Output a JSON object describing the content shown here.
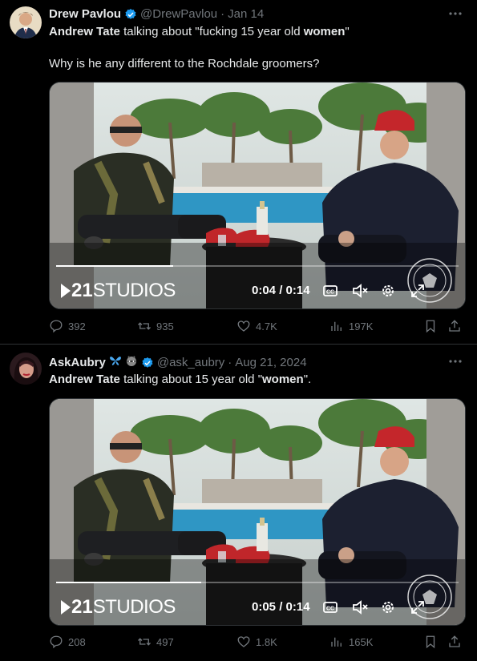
{
  "tweets": [
    {
      "author_name": "Drew Pavlou",
      "handle": "@DrewPavlou",
      "dot": "·",
      "date": "Jan 14",
      "line1_a": "Andrew Tate",
      "line1_b": " talking about \"fucking 15 year old ",
      "line1_c": "women",
      "line1_d": "\"",
      "line2": "Why is he any different to the Rochdale groomers?",
      "video": {
        "logo_num": "21",
        "logo_text": "STUDIOS",
        "time": "0:04 / 0:14",
        "progress": 0.29
      },
      "stats": {
        "replies": "392",
        "reposts": "935",
        "likes": "4.7K",
        "views": "197K"
      }
    },
    {
      "author_name": "AskAubry",
      "handle": "@ask_aubry",
      "dot": "·",
      "date": "Aug 21, 2024",
      "line1_a": "Andrew Tate",
      "line1_b": " talking about 15 year old \"",
      "line1_c": "women",
      "line1_d": "\".",
      "video": {
        "logo_num": "21",
        "logo_text": "STUDIOS",
        "time": "0:05 / 0:14",
        "progress": 0.36
      },
      "stats": {
        "replies": "208",
        "reposts": "497",
        "likes": "1.8K",
        "views": "165K"
      }
    }
  ],
  "colors": {
    "background": "#000000",
    "text": "#e7e9ea",
    "muted": "#71767b",
    "verified": "#1d9bf0",
    "divider": "#2f3336"
  },
  "icons": [
    "more-icon",
    "verified-badge-icon",
    "butterfly-icon",
    "raccoon-icon",
    "reply-icon",
    "repost-icon",
    "like-icon",
    "views-icon",
    "bookmark-icon",
    "share-icon",
    "cc-icon",
    "mute-icon",
    "settings-icon",
    "fullscreen-icon"
  ]
}
